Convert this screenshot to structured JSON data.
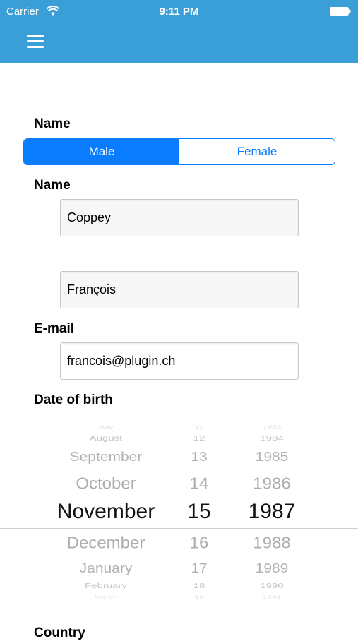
{
  "status_bar": {
    "carrier": "Carrier",
    "time": "9:11 PM"
  },
  "navbar": {
    "background": "#3a9fd6",
    "menu_icon": "hamburger-menu-icon"
  },
  "form": {
    "gender_label": "Name",
    "gender_options": [
      "Male",
      "Female"
    ],
    "gender_selected": "Male",
    "name_label": "Name",
    "last_name_value": "Coppey",
    "first_name_value": "François",
    "email_label": "E-mail",
    "email_value": "francois@plugin.ch",
    "dob_label": "Date of birth",
    "country_label": "Country"
  },
  "date_picker": {
    "rows": [
      {
        "month": "July",
        "day": "11",
        "year": "1983"
      },
      {
        "month": "August",
        "day": "12",
        "year": "1984"
      },
      {
        "month": "September",
        "day": "13",
        "year": "1985"
      },
      {
        "month": "October",
        "day": "14",
        "year": "1986"
      },
      {
        "month": "November",
        "day": "15",
        "year": "1987"
      },
      {
        "month": "December",
        "day": "16",
        "year": "1988"
      },
      {
        "month": "January",
        "day": "17",
        "year": "1989"
      },
      {
        "month": "February",
        "day": "18",
        "year": "1990"
      },
      {
        "month": "March",
        "day": "19",
        "year": "1991"
      }
    ],
    "selected_index": 4
  },
  "accent_color": "#0a7cff"
}
